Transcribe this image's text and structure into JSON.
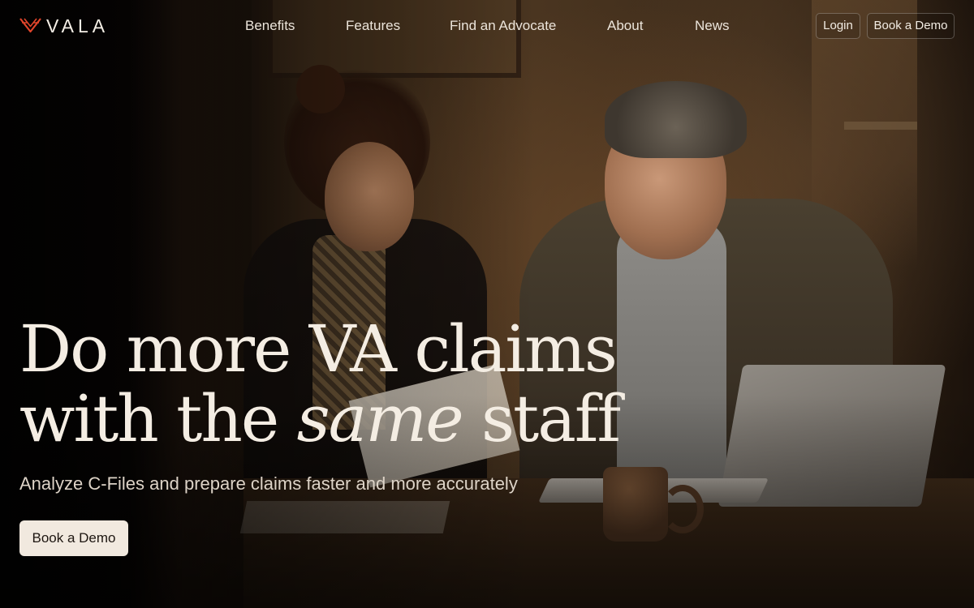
{
  "brand": {
    "name": "VALA",
    "logo_icon": "wing-chevron-icon",
    "accent_color": "#e0452b"
  },
  "nav": {
    "links": [
      "Benefits",
      "Features",
      "Find an Advocate",
      "About",
      "News"
    ],
    "login_label": "Login",
    "demo_label": "Book a Demo"
  },
  "hero": {
    "title_line1": "Do more VA claims",
    "title_line2_pre": "with the ",
    "title_line2_em": "same",
    "title_line2_post": " staff",
    "subtitle": "Analyze C-Files and prepare claims faster and more accurately",
    "cta_label": "Book a Demo",
    "background_image": "photo of woman reviewing paperwork with older man at table with laptop and mug"
  },
  "colors": {
    "text_primary": "#f4ede3",
    "cta_background": "#f1e9df",
    "cta_text": "#1d1611"
  }
}
